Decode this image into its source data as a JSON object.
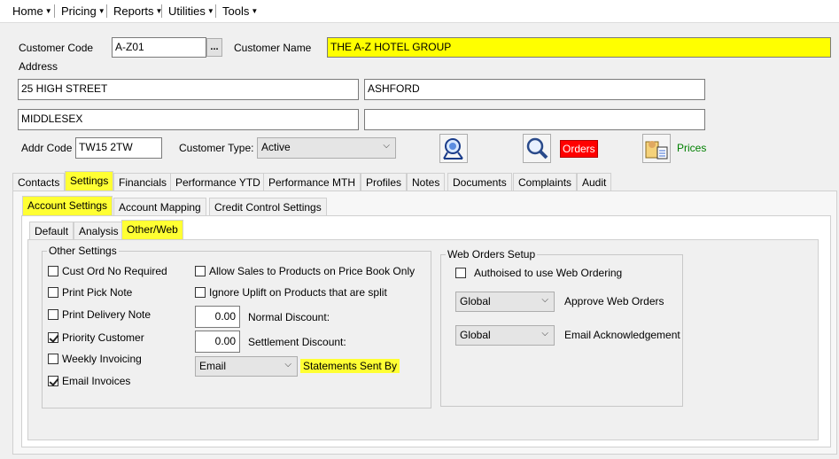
{
  "menu": {
    "items": [
      "Home",
      "Pricing",
      "Reports",
      "Utilities",
      "Tools"
    ]
  },
  "customer": {
    "code_label": "Customer Code",
    "code_value": "A-Z01",
    "ellipsis": "...",
    "name_label": "Customer Name",
    "name_value": "THE A-Z HOTEL GROUP"
  },
  "address": {
    "label": "Address",
    "line1": "25 HIGH STREET",
    "line2": "ASHFORD",
    "line3": "MIDDLESEX",
    "line4": "",
    "addr_code_label": "Addr Code",
    "addr_code_value": "TW15  2TW",
    "customer_type_label": "Customer Type:",
    "customer_type_value": "Active"
  },
  "actions": {
    "orders_label": "Orders",
    "prices_label": "Prices",
    "icons": [
      "search-map-icon",
      "magnify-icon",
      "prices-icon"
    ]
  },
  "main_tabs": [
    "Contacts",
    "Settings",
    "Financials",
    "Performance YTD",
    "Performance MTH",
    "Profiles",
    "Notes",
    "Documents",
    "Complaints",
    "Audit"
  ],
  "settings_tabs": [
    "Account Settings",
    "Account Mapping",
    "Credit Control Settings"
  ],
  "account_tabs": [
    "Default",
    "Analysis",
    "Other/Web"
  ],
  "other_settings": {
    "title": "Other Settings",
    "checkboxes": [
      {
        "label": "Cust Ord No Required",
        "checked": false
      },
      {
        "label": "Print Pick Note",
        "checked": false
      },
      {
        "label": "Print Delivery Note",
        "checked": false
      },
      {
        "label": "Priority Customer",
        "checked": true
      },
      {
        "label": "Weekly Invoicing",
        "checked": false
      },
      {
        "label": "Email Invoices",
        "checked": true
      }
    ],
    "allow_sales_label": "Allow Sales to Products on Price Book Only",
    "ignore_uplift_label": "Ignore Uplift on Products that are split",
    "normal_discount_value": "0.00",
    "normal_discount_label": "Normal Discount:",
    "settlement_discount_value": "0.00",
    "settlement_discount_label": "Settlement Discount:",
    "statements_value": "Email",
    "statements_label": "Statements Sent By"
  },
  "web_orders": {
    "title": "Web Orders Setup",
    "authorised_label": "Authoised to use Web Ordering",
    "approve_value": "Global",
    "approve_label": "Approve Web Orders",
    "email_ack_value": "Global",
    "email_ack_label": "Email Acknowledgement"
  },
  "colors": {
    "highlight": "#ffff00",
    "orders_bg": "#ff0000",
    "prices_text": "#008000"
  }
}
